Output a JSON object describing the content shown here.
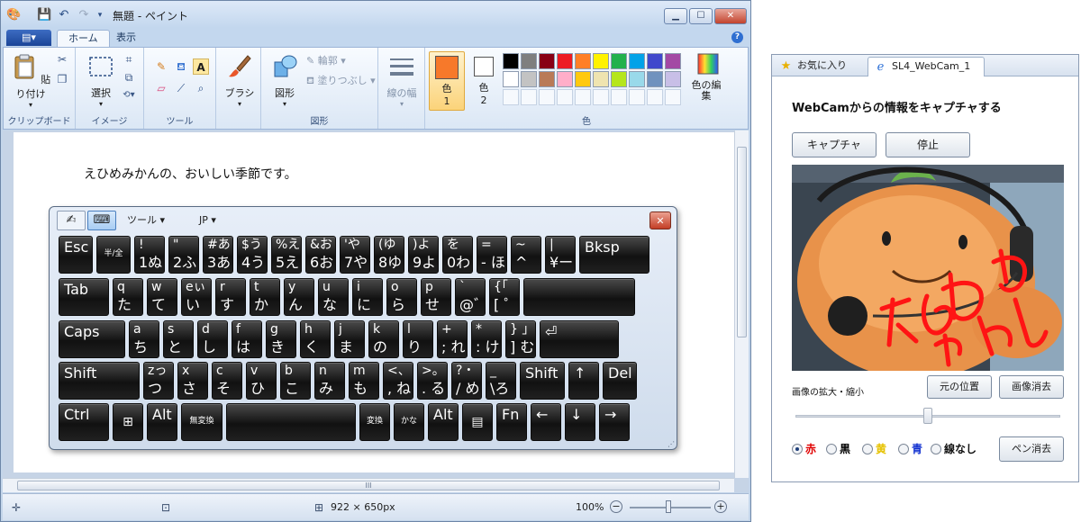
{
  "paint": {
    "title": "無題 - ペイント",
    "tabs": {
      "file": "▤▾",
      "home": "ホーム",
      "view": "表示"
    },
    "clipboard": {
      "paste": "貼り付け",
      "group": "クリップボード"
    },
    "image": {
      "select": "選択",
      "group": "イメージ"
    },
    "tools": {
      "group": "ツール",
      "text_tool": "A"
    },
    "brush": {
      "label": "ブラシ"
    },
    "shapes": {
      "label": "図形",
      "outline": "輪郭",
      "fill": "塗りつぶし",
      "group": "図形"
    },
    "line_width": {
      "label": "線の幅"
    },
    "colors": {
      "color1": "色",
      "color1_num": "1",
      "color2": "色",
      "color2_num": "2",
      "group": "色",
      "edit": "色の編集",
      "color1_value": "#f7792a",
      "color2_value": "#ffffff",
      "palette_row1": [
        "#000000",
        "#7f7f7f",
        "#880015",
        "#ed1c24",
        "#ff7f27",
        "#fff200",
        "#22b14c",
        "#00a2e8",
        "#3f48cc",
        "#a349a4"
      ],
      "palette_row2": [
        "#ffffff",
        "#c3c3c3",
        "#b97a57",
        "#ffaec9",
        "#ffc90e",
        "#efe4b0",
        "#b5e61d",
        "#99d9ea",
        "#7092be",
        "#c8bfe7"
      ]
    },
    "canvas_text": "えひめみかんの、おいしい季節です。",
    "status": {
      "canvas_size": "922 × 650px",
      "zoom": "100%",
      "minus": "−",
      "plus": "+"
    },
    "scroll_grip": "III"
  },
  "osk": {
    "tools_menu": "ツール",
    "language": "JP",
    "close": "✕",
    "rows": [
      [
        {
          "main": "Esc",
          "w": 40
        },
        {
          "small": "半/全",
          "w": 40
        },
        {
          "tl": "!",
          "bl": "1ぬ",
          "w": 36
        },
        {
          "tl": "\"",
          "bl": "2ふ",
          "w": 36
        },
        {
          "tl": "#あ",
          "bl": "3あ",
          "w": 36
        },
        {
          "tl": "$う",
          "bl": "4う",
          "w": 36
        },
        {
          "tl": "%え",
          "bl": "5え",
          "w": 36
        },
        {
          "tl": "&お",
          "bl": "6お",
          "w": 36
        },
        {
          "tl": "'や",
          "bl": "7や",
          "w": 36
        },
        {
          "tl": "(ゆ",
          "bl": "8ゆ",
          "w": 36
        },
        {
          "tl": ")よ",
          "bl": "9よ",
          "w": 36
        },
        {
          "tl": "を",
          "bl": "0わ",
          "w": 36
        },
        {
          "tl": "=",
          "bl": "- ほ",
          "w": 36
        },
        {
          "tl": "~",
          "bl": "^へ",
          "w": 36
        },
        {
          "tl": "|",
          "bl": "¥ー",
          "w": 36
        },
        {
          "main": "Bksp",
          "w": 80
        }
      ],
      [
        {
          "main": "Tab",
          "w": 58
        },
        {
          "tl": "q",
          "bl": " た",
          "w": 36
        },
        {
          "tl": "w",
          "bl": " て",
          "w": 36
        },
        {
          "tl": "eぃ",
          "bl": " い",
          "w": 36
        },
        {
          "tl": "r",
          "bl": " す",
          "w": 36
        },
        {
          "tl": "t",
          "bl": " か",
          "w": 36
        },
        {
          "tl": "y",
          "bl": " ん",
          "w": 36
        },
        {
          "tl": "u",
          "bl": " な",
          "w": 36
        },
        {
          "tl": "i",
          "bl": " に",
          "w": 36
        },
        {
          "tl": "o",
          "bl": " ら",
          "w": 36
        },
        {
          "tl": "p",
          "bl": " せ",
          "w": 36
        },
        {
          "tl": "`",
          "bl": " @゛",
          "w": 36
        },
        {
          "tl": "{「",
          "bl": "[ ゜",
          "w": 36
        },
        {
          "main": "",
          "w": 126
        }
      ],
      [
        {
          "main": "Caps",
          "w": 76
        },
        {
          "tl": "a",
          "bl": " ち",
          "w": 36
        },
        {
          "tl": "s",
          "bl": " と",
          "w": 36
        },
        {
          "tl": "d",
          "bl": " し",
          "w": 36
        },
        {
          "tl": "f",
          "bl": " は",
          "w": 36
        },
        {
          "tl": "g",
          "bl": " き",
          "w": 36
        },
        {
          "tl": "h",
          "bl": " く",
          "w": 36
        },
        {
          "tl": "j",
          "bl": " ま",
          "w": 36
        },
        {
          "tl": "k",
          "bl": " の",
          "w": 36
        },
        {
          "tl": "l",
          "bl": " り",
          "w": 36
        },
        {
          "tl": "+",
          "bl": "; れ",
          "w": 36
        },
        {
          "tl": "*",
          "bl": ": け",
          "w": 36
        },
        {
          "tl": "} 」",
          "bl": "] む",
          "w": 36
        },
        {
          "main": "⏎",
          "w": 90
        }
      ],
      [
        {
          "main": "Shift",
          "w": 92
        },
        {
          "tl": "zっ",
          "bl": " つ",
          "w": 36
        },
        {
          "tl": "x",
          "bl": " さ",
          "w": 36
        },
        {
          "tl": "c",
          "bl": " そ",
          "w": 36
        },
        {
          "tl": "v",
          "bl": " ひ",
          "w": 36
        },
        {
          "tl": "b",
          "bl": " こ",
          "w": 36
        },
        {
          "tl": "n",
          "bl": " み",
          "w": 36
        },
        {
          "tl": "m",
          "bl": " も",
          "w": 36
        },
        {
          "tl": "<、",
          "bl": ", ね",
          "w": 36
        },
        {
          "tl": ">。",
          "bl": ". る",
          "w": 36
        },
        {
          "tl": "?・",
          "bl": "/ め",
          "w": 36
        },
        {
          "tl": "_",
          "bl": "\\ろ",
          "w": 36
        },
        {
          "main": "Shift",
          "w": 52
        },
        {
          "main": "↑",
          "w": 36
        },
        {
          "main": "Del",
          "w": 40
        }
      ],
      [
        {
          "main": "Ctrl",
          "w": 58
        },
        {
          "center": "⊞",
          "w": 36
        },
        {
          "main": "Alt",
          "w": 36
        },
        {
          "small": "無変換",
          "w": 48
        },
        {
          "center": "",
          "w": 146
        },
        {
          "small": "変換",
          "w": 36
        },
        {
          "small": "かな",
          "w": 36
        },
        {
          "main": "Alt",
          "w": 36
        },
        {
          "center": "▤",
          "w": 36
        },
        {
          "main": "Fn",
          "w": 36
        },
        {
          "main": "←",
          "w": 36
        },
        {
          "main": "↓",
          "w": 36
        },
        {
          "main": "→",
          "w": 36
        }
      ]
    ]
  },
  "browser": {
    "favorites_tab": "お気に入り",
    "page_tab": "SL4_WebCam_1",
    "heading": "WebCamからの情報をキャプチャする",
    "capture_button": "キャプチャ",
    "stop_button": "停止",
    "zoom_label": "画像の拡大・縮小",
    "reset_position_button": "元の位置",
    "clear_image_button": "画像消去",
    "zoom_value": 0.5,
    "pen_colors": [
      {
        "label": "赤",
        "color": "#e00000",
        "checked": true
      },
      {
        "label": "黒",
        "color": "#000000",
        "checked": false
      },
      {
        "label": "黄",
        "color": "#e6c200",
        "checked": false
      },
      {
        "label": "青",
        "color": "#1030d0",
        "checked": false
      },
      {
        "label": "線なし",
        "color": "#111111",
        "checked": false
      }
    ],
    "clear_pen_button": "ペン消去"
  }
}
